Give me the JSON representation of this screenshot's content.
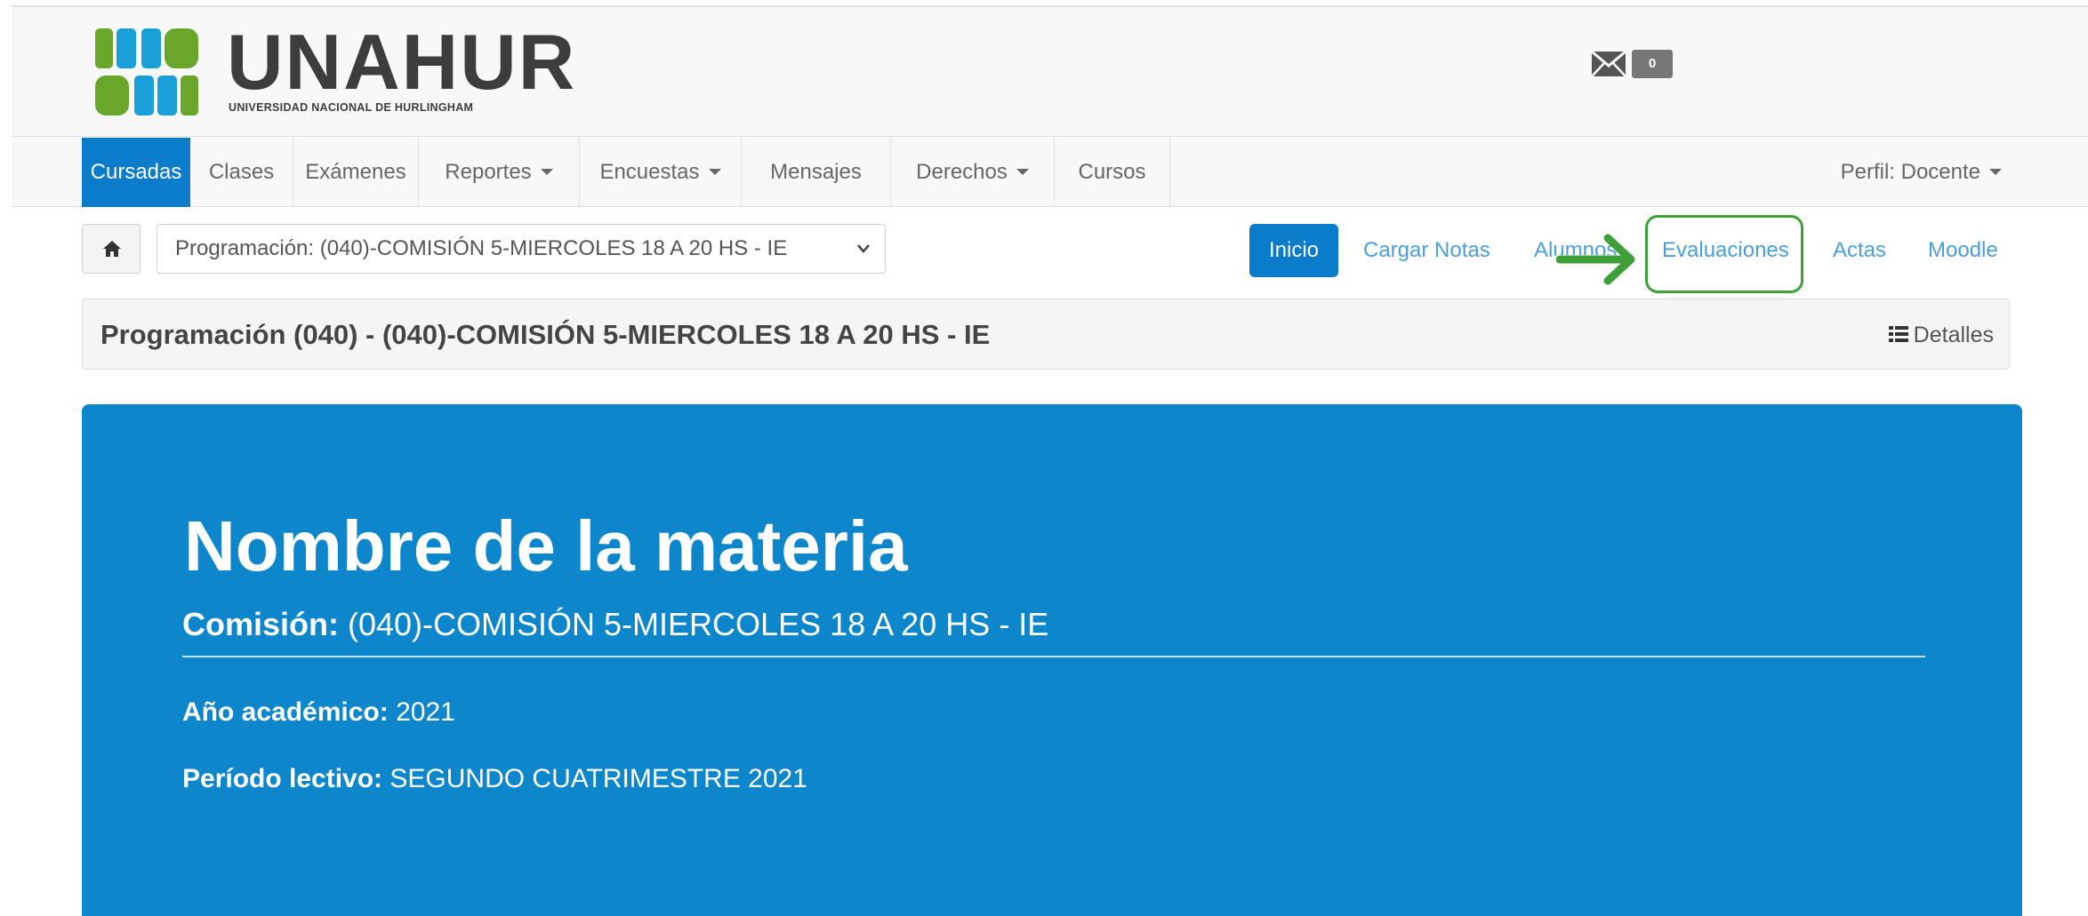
{
  "brand": {
    "name": "UNAHUR",
    "subtitle": "UNIVERSIDAD NACIONAL DE HURLINGHAM",
    "colors": {
      "green": "#6aa62a",
      "blue": "#1aa0d8",
      "text": "#3b3d3f"
    }
  },
  "header": {
    "mail_icon": "envelope-icon",
    "mail_count": "0"
  },
  "nav": {
    "items": [
      {
        "label": "Cursadas",
        "active": true
      },
      {
        "label": "Clases"
      },
      {
        "label": "Exámenes"
      },
      {
        "label": "Reportes",
        "dropdown": true
      },
      {
        "label": "Encuestas",
        "dropdown": true
      },
      {
        "label": "Mensajes"
      },
      {
        "label": "Derechos",
        "dropdown": true
      },
      {
        "label": "Cursos"
      }
    ],
    "profile_label": "Perfil: Docente"
  },
  "toolbar": {
    "home_icon": "home-icon",
    "program_select_value": "Programación: (040)-COMISIÓN 5-MIERCOLES 18 A 20 HS - IE",
    "subnav": [
      {
        "label": "Inicio",
        "active": true
      },
      {
        "label": "Cargar Notas"
      },
      {
        "label": "Alumnos"
      },
      {
        "label": "Evaluaciones",
        "highlighted": true
      },
      {
        "label": "Actas"
      },
      {
        "label": "Moodle"
      }
    ]
  },
  "programacion_panel": {
    "title": "Programación (040) - (040)-COMISIÓN 5-MIERCOLES 18 A 20 HS - IE",
    "details_label": "Detalles",
    "details_icon": "list-icon"
  },
  "hero": {
    "title": "Nombre de la materia",
    "comision_label": "Comisión:",
    "comision_value": " (040)-COMISIÓN 5-MIERCOLES 18 A 20 HS - IE",
    "anio_label": "Año académico:",
    "anio_value": " 2021",
    "periodo_label": "Período lectivo:",
    "periodo_value": " SEGUNDO CUATRIMESTRE 2021",
    "background_color": "#0d86cc"
  },
  "annotation": {
    "arrow_color": "#3fa039",
    "arrow_icon": "arrow-right-icon"
  }
}
